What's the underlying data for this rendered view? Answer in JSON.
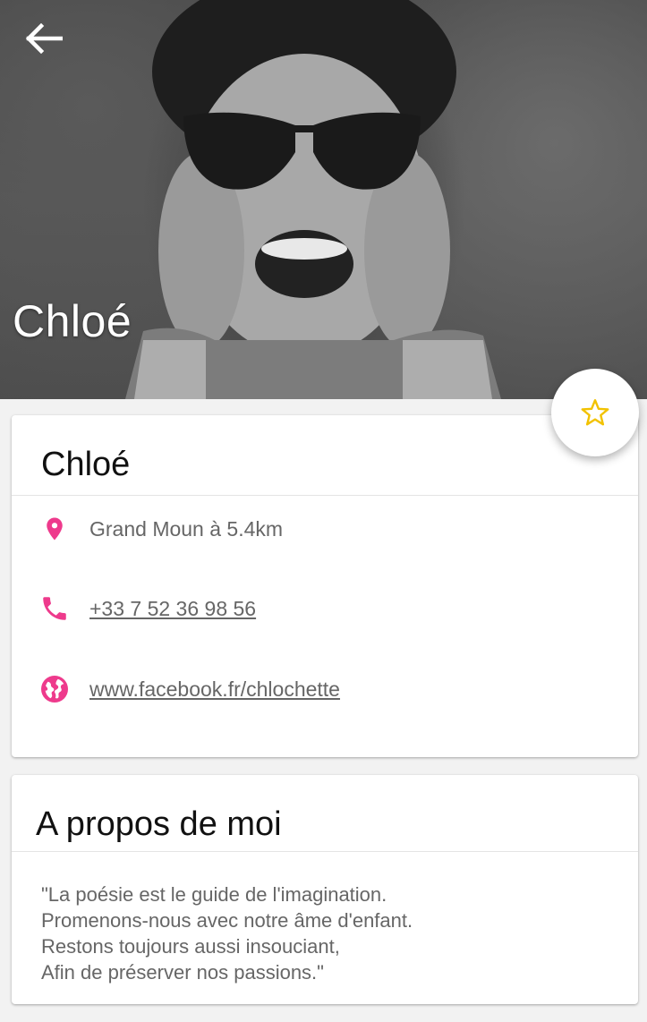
{
  "header": {
    "name": "Chloé",
    "back_icon": "arrow-left-icon",
    "favorite_icon": "star-outline-icon"
  },
  "profile_card": {
    "name": "Chloé",
    "location": "Grand Moun à 5.4km",
    "phone": "+33 7 52 36 98 56",
    "website": "www.facebook.fr/chlochette",
    "icons": [
      "location-pin-icon",
      "phone-icon",
      "globe-icon"
    ]
  },
  "about_card": {
    "title": "A propos de moi",
    "quote_lines": [
      "\"La poésie est le guide de l'imagination.",
      "Promenons-nous avec notre âme d'enfant.",
      "Restons toujours aussi insouciant,",
      "Afin de préserver nos passions.\""
    ]
  },
  "colors": {
    "accent": "#ee3a8c",
    "star": "#f2c200",
    "text_secondary": "#666666"
  }
}
